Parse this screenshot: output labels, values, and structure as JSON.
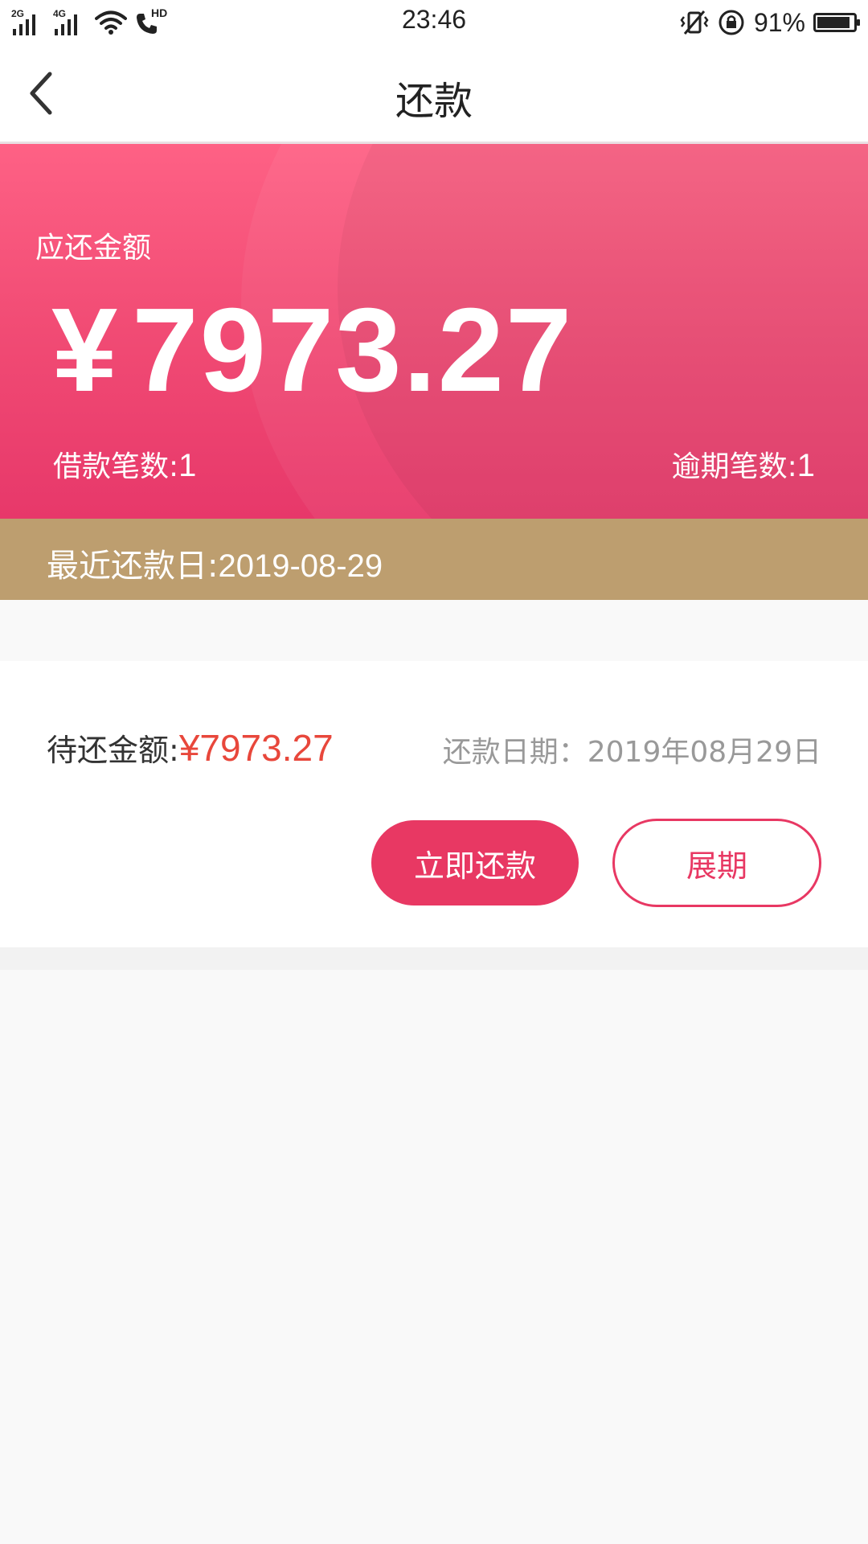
{
  "status_bar": {
    "time": "23:46",
    "battery_percent": "91%",
    "battery_level": 0.91,
    "signal_1_tag": "2G",
    "signal_2_tag": "4G",
    "call_tag": "HD",
    "icons": [
      "signal-icon",
      "signal-icon",
      "wifi-icon",
      "hd-call-icon",
      "vibrate-icon",
      "rotation-lock-icon",
      "battery-icon"
    ]
  },
  "nav": {
    "title": "还款",
    "back_icon": "chevron-left-icon"
  },
  "hero": {
    "label": "应还金额",
    "currency": "¥",
    "amount": "7973.27",
    "loan_count_label": "借款笔数:",
    "loan_count": "1",
    "overdue_count_label": "逾期笔数:",
    "overdue_count": "1",
    "colors": {
      "top": "#fe6185",
      "bottom": "#e7386a"
    }
  },
  "recent": {
    "label": "最近还款日:",
    "date": "2019-08-29",
    "color": "#bd9e6f"
  },
  "repay_item": {
    "pending_label": "待还金额:",
    "pending_amount": "¥7973.27",
    "due_label": "还款日期：2019年08月29日",
    "pay_button": "立即还款",
    "extend_button": "展期",
    "accent_color": "#e83863",
    "amount_color": "#e8473b"
  }
}
